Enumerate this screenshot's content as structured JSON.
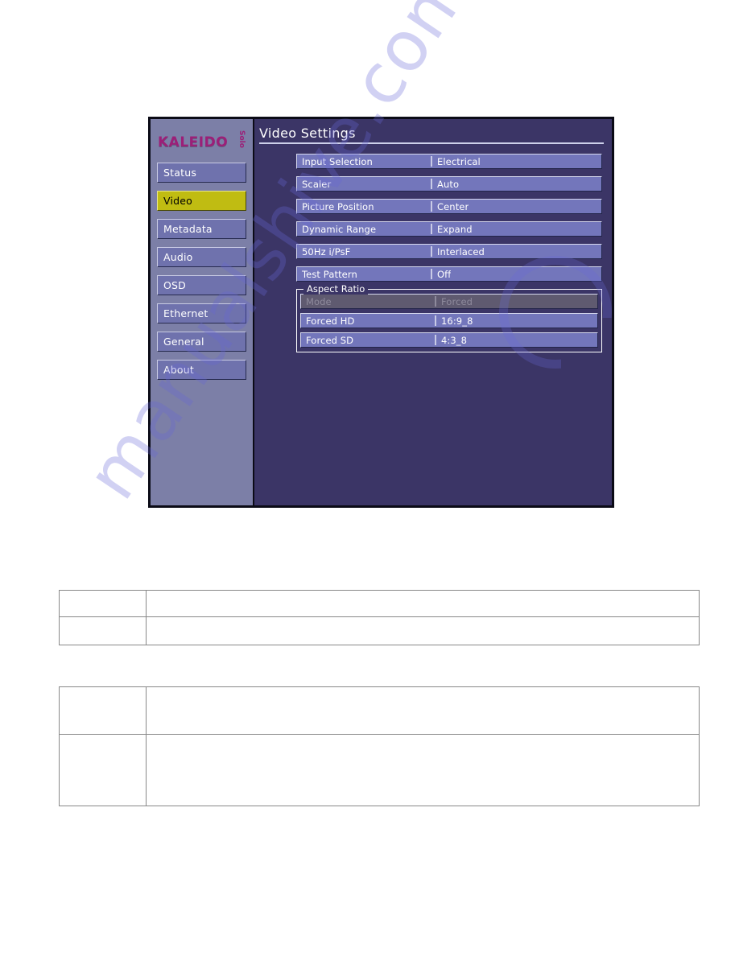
{
  "page": {
    "background_color": "#ffffff",
    "watermark": {
      "text": "manualshive.com",
      "color": "#6868d6"
    }
  },
  "device_ui": {
    "panel_background": "#3b3566",
    "sidebar_background": "#7c7fa7",
    "accent_selected": "#c0bc12",
    "brand": {
      "wordmark": "KALEIDO",
      "submark": "Solo",
      "color": "#9c1f78"
    },
    "nav": {
      "items": [
        {
          "label": "Status",
          "selected": false
        },
        {
          "label": "Video",
          "selected": true
        },
        {
          "label": "Metadata",
          "selected": false
        },
        {
          "label": "Audio",
          "selected": false
        },
        {
          "label": "OSD",
          "selected": false
        },
        {
          "label": "Ethernet",
          "selected": false
        },
        {
          "label": "General",
          "selected": false
        },
        {
          "label": "About",
          "selected": false
        }
      ]
    },
    "content": {
      "title": "Video Settings",
      "fields": [
        {
          "label": "Input Selection",
          "value": "Electrical",
          "disabled": false
        },
        {
          "label": "Scaler",
          "value": "Auto",
          "disabled": false
        },
        {
          "label": "Picture Position",
          "value": "Center",
          "disabled": false
        },
        {
          "label": "Dynamic Range",
          "value": "Expand",
          "disabled": false
        },
        {
          "label": "50Hz i/PsF",
          "value": "Interlaced",
          "disabled": false
        },
        {
          "label": "Test Pattern",
          "value": "Off",
          "disabled": false
        }
      ],
      "aspect_ratio_group": {
        "legend": "Aspect Ratio",
        "fields": [
          {
            "label": "Mode",
            "value": "Forced",
            "disabled": true
          },
          {
            "label": "Forced HD",
            "value": "16:9_8",
            "disabled": false
          },
          {
            "label": "Forced SD",
            "value": "4:3_8",
            "disabled": false
          }
        ]
      }
    }
  },
  "doc_tables": [
    {
      "name": "table-one",
      "rows": [
        {
          "cells": [
            "",
            ""
          ]
        },
        {
          "cells": [
            "",
            ""
          ]
        }
      ]
    },
    {
      "name": "table-two",
      "rows": [
        {
          "cells": [
            "",
            ""
          ]
        },
        {
          "cells": [
            "",
            ""
          ]
        }
      ]
    }
  ]
}
